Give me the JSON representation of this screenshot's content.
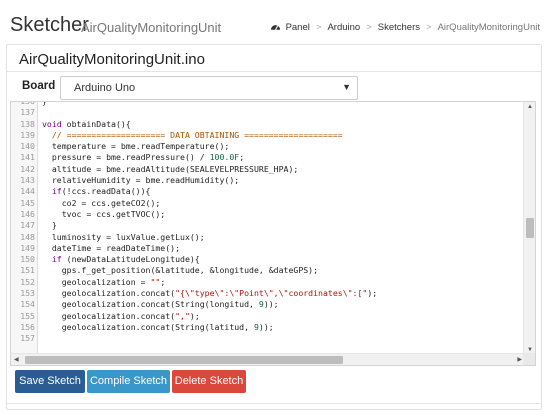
{
  "header": {
    "title": "Sketcher",
    "subtitle": "AirQualityMonitoringUnit",
    "breadcrumb": [
      {
        "label": "Panel",
        "icon": "dashboard-icon"
      },
      {
        "label": "Arduino"
      },
      {
        "label": "Sketchers"
      },
      {
        "label": "AirQualityMonitoringUnit"
      }
    ],
    "breadcrumb_separator": ">"
  },
  "card": {
    "file_title": "AirQualityMonitoringUnit.ino",
    "board_label": "Board",
    "board_selected": "Arduino Uno",
    "board_caret": "▼"
  },
  "editor": {
    "lines": [
      {
        "n": "136",
        "code": "}"
      },
      {
        "n": "137",
        "code": ""
      },
      {
        "n": "138",
        "code": "void obtainData(){"
      },
      {
        "n": "139",
        "code": "  // ==================== DATA OBTAINING ===================="
      },
      {
        "n": "140",
        "code": "  temperature = bme.readTemperature();"
      },
      {
        "n": "141",
        "code": "  pressure = bme.readPressure() / 100.0F;"
      },
      {
        "n": "142",
        "code": "  altitude = bme.readAltitude(SEALEVELPRESSURE_HPA);"
      },
      {
        "n": "143",
        "code": "  relativeHumidity = bme.readHumidity();"
      },
      {
        "n": "144",
        "code": "  if(!ccs.readData()){"
      },
      {
        "n": "145",
        "code": "    co2 = ccs.geteCO2();"
      },
      {
        "n": "146",
        "code": "    tvoc = ccs.getTVOC();"
      },
      {
        "n": "147",
        "code": "  }"
      },
      {
        "n": "148",
        "code": "  luminosity = luxValue.getLux();"
      },
      {
        "n": "149",
        "code": "  dateTime = readDateTime();"
      },
      {
        "n": "150",
        "code": "  if (newDataLatitudeLongitude){"
      },
      {
        "n": "151",
        "code": "    gps.f_get_position(&latitude, &longitude, &dateGPS);"
      },
      {
        "n": "152",
        "code": "    geolocalization = \"\";"
      },
      {
        "n": "153",
        "code": "    geolocalization.concat(\"{\\\"type\\\":\\\"Point\\\",\\\"coordinates\\\":[\");"
      },
      {
        "n": "154",
        "code": "    geolocalization.concat(String(longitud, 9));"
      },
      {
        "n": "155",
        "code": "    geolocalization.concat(\",\");"
      },
      {
        "n": "156",
        "code": "    geolocalization.concat(String(latitud, 9));"
      },
      {
        "n": "157",
        "code": ""
      }
    ],
    "scroll_up": "▲",
    "scroll_down": "▼",
    "scroll_left": "◀",
    "scroll_right": "▶"
  },
  "buttons": {
    "save": "Save Sketch",
    "compile": "Compile Sketch",
    "delete": "Delete Sketch"
  },
  "colors": {
    "save": "#2b5d93",
    "compile": "#3a97c9",
    "delete": "#d9473d"
  }
}
